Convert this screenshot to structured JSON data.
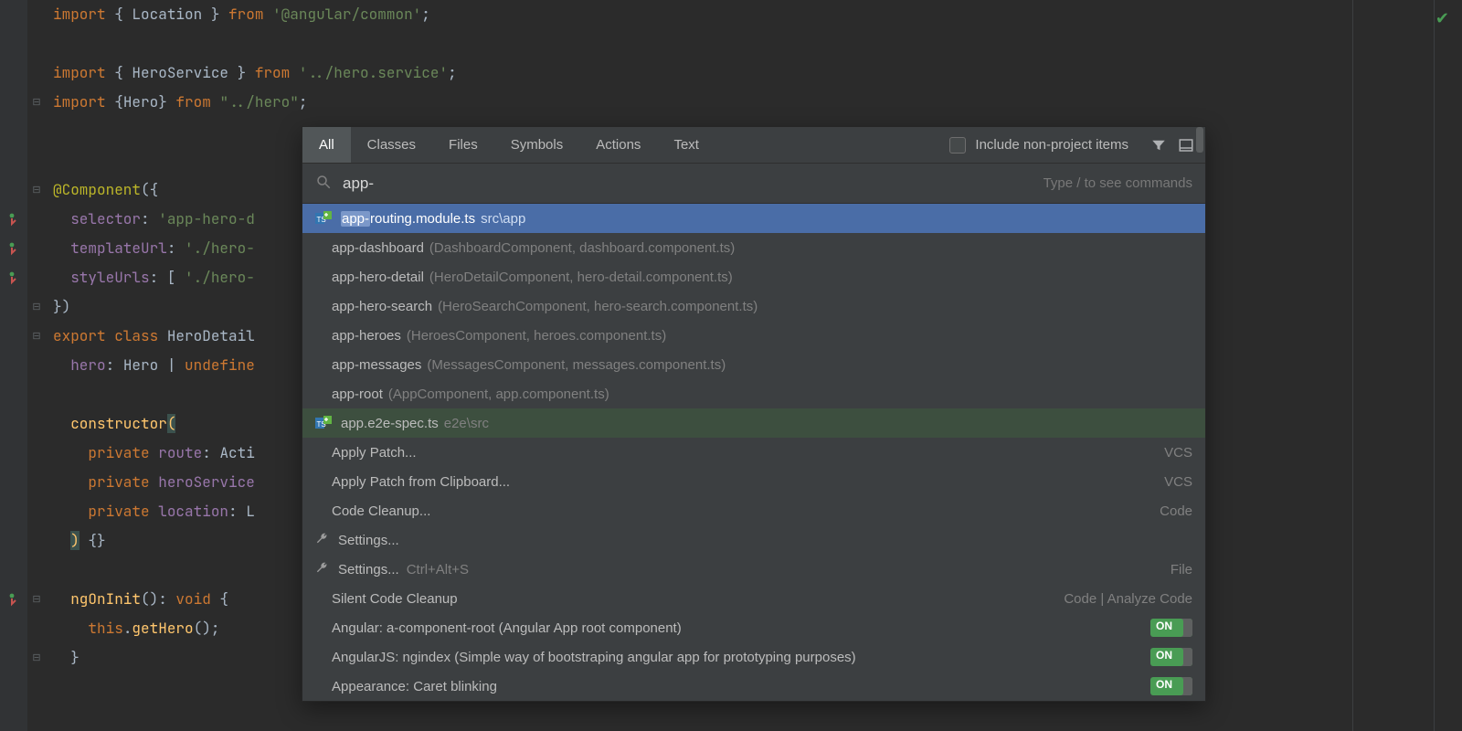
{
  "code": {
    "lines": [
      {
        "t": "import",
        "segs": [
          [
            "kw",
            "import"
          ],
          [
            "",
            " { "
          ],
          [
            "ident",
            "Location"
          ],
          [
            "",
            " } "
          ],
          [
            "kw",
            "from"
          ],
          [
            "",
            " "
          ],
          [
            "str",
            "'@angular/common'"
          ],
          [
            "",
            ";"
          ]
        ]
      },
      {
        "t": "blank"
      },
      {
        "t": "import",
        "segs": [
          [
            "kw",
            "import"
          ],
          [
            "",
            " { "
          ],
          [
            "ident",
            "HeroService"
          ],
          [
            "",
            " } "
          ],
          [
            "kw",
            "from"
          ],
          [
            "",
            " "
          ],
          [
            "str",
            "'../hero.service'"
          ],
          [
            "",
            ";"
          ]
        ]
      },
      {
        "t": "import",
        "segs": [
          [
            "kw",
            "import"
          ],
          [
            "",
            " {"
          ],
          [
            "ident",
            "Hero"
          ],
          [
            "",
            "} "
          ],
          [
            "kw",
            "from"
          ],
          [
            "",
            " "
          ],
          [
            "str",
            "\"../hero\""
          ],
          [
            "",
            ";"
          ]
        ]
      },
      {
        "t": "blank"
      },
      {
        "t": "blank"
      },
      {
        "t": "decor",
        "segs": [
          [
            "decor",
            "@Component"
          ],
          [
            "",
            "({"
          ]
        ]
      },
      {
        "t": "prop",
        "segs": [
          [
            "",
            "  "
          ],
          [
            "prop",
            "selector"
          ],
          [
            "",
            ": "
          ],
          [
            "str",
            "'app-hero-d"
          ]
        ]
      },
      {
        "t": "prop",
        "segs": [
          [
            "",
            "  "
          ],
          [
            "prop",
            "templateUrl"
          ],
          [
            "",
            ": "
          ],
          [
            "str",
            "'./hero-"
          ]
        ]
      },
      {
        "t": "prop",
        "segs": [
          [
            "",
            "  "
          ],
          [
            "prop",
            "styleUrls"
          ],
          [
            "",
            ": [ "
          ],
          [
            "str",
            "'./hero-"
          ]
        ]
      },
      {
        "t": "close",
        "segs": [
          [
            "",
            "})"
          ]
        ]
      },
      {
        "t": "class",
        "segs": [
          [
            "kw",
            "export class "
          ],
          [
            "ident",
            "HeroDetail"
          ]
        ]
      },
      {
        "t": "field",
        "segs": [
          [
            "",
            "  "
          ],
          [
            "prop",
            "hero"
          ],
          [
            "",
            ": "
          ],
          [
            "type",
            "Hero"
          ],
          [
            "",
            " | "
          ],
          [
            "kw",
            "undefine"
          ]
        ]
      },
      {
        "t": "blank"
      },
      {
        "t": "ctor",
        "segs": [
          [
            "",
            "  "
          ],
          [
            "fn",
            "constructor"
          ],
          [
            "par-y",
            "("
          ]
        ]
      },
      {
        "t": "param",
        "segs": [
          [
            "",
            "    "
          ],
          [
            "kw",
            "private "
          ],
          [
            "prop",
            "route"
          ],
          [
            "",
            ": "
          ],
          [
            "type",
            "Acti"
          ]
        ]
      },
      {
        "t": "param",
        "segs": [
          [
            "",
            "    "
          ],
          [
            "kw",
            "private "
          ],
          [
            "prop",
            "heroService"
          ]
        ]
      },
      {
        "t": "param",
        "segs": [
          [
            "",
            "    "
          ],
          [
            "kw",
            "private "
          ],
          [
            "prop",
            "location"
          ],
          [
            "",
            ": "
          ],
          [
            "type",
            "L"
          ]
        ]
      },
      {
        "t": "close",
        "segs": [
          [
            "",
            "  "
          ],
          [
            "par-y",
            ")"
          ],
          [
            "",
            " {}"
          ]
        ]
      },
      {
        "t": "blank"
      },
      {
        "t": "method",
        "segs": [
          [
            "",
            "  "
          ],
          [
            "fn",
            "ngOnInit"
          ],
          [
            "",
            "(): "
          ],
          [
            "kw",
            "void"
          ],
          [
            "",
            " {"
          ]
        ]
      },
      {
        "t": "call",
        "segs": [
          [
            "",
            "    "
          ],
          [
            "kw",
            "this"
          ],
          [
            "",
            "."
          ],
          [
            "fn",
            "getHero"
          ],
          [
            "",
            "();"
          ]
        ]
      },
      {
        "t": "close",
        "segs": [
          [
            "",
            "  }"
          ]
        ]
      },
      {
        "t": "blank"
      }
    ]
  },
  "gutter_marks": [
    {
      "line": 8,
      "kind": "implements"
    },
    {
      "line": 9,
      "kind": "implements"
    },
    {
      "line": 10,
      "kind": "implements"
    },
    {
      "line": 21,
      "kind": "implements"
    }
  ],
  "folds": [
    {
      "line": 4,
      "glyph": "⊟"
    },
    {
      "line": 7,
      "glyph": "⊟"
    },
    {
      "line": 11,
      "glyph": "⊟"
    },
    {
      "line": 12,
      "glyph": "⊟"
    },
    {
      "line": 15,
      "glyph": ""
    },
    {
      "line": 19,
      "glyph": ""
    },
    {
      "line": 21,
      "glyph": "⊟"
    },
    {
      "line": 23,
      "glyph": "⊟"
    }
  ],
  "popup": {
    "tabs": [
      "All",
      "Classes",
      "Files",
      "Symbols",
      "Actions",
      "Text"
    ],
    "active_tab": 0,
    "include_label": "Include non-project items",
    "query": "app-",
    "hint": "Type / to see commands",
    "results": [
      {
        "icon": "ts",
        "match": "app-",
        "label": "routing.module.ts",
        "dim": "src\\app",
        "selected": true
      },
      {
        "label": "app-dashboard",
        "dim": "(DashboardComponent, dashboard.component.ts)"
      },
      {
        "label": "app-hero-detail",
        "dim": "(HeroDetailComponent, hero-detail.component.ts)"
      },
      {
        "label": "app-hero-search",
        "dim": "(HeroSearchComponent, hero-search.component.ts)"
      },
      {
        "label": "app-heroes",
        "dim": "(HeroesComponent, heroes.component.ts)"
      },
      {
        "label": "app-messages",
        "dim": "(MessagesComponent, messages.component.ts)"
      },
      {
        "label": "app-root",
        "dim": "(AppComponent, app.component.ts)"
      },
      {
        "icon": "ts",
        "label": "app.e2e-spec.ts",
        "dim": "e2e\\src",
        "hl": true
      },
      {
        "label": "Apply Patch...",
        "right": "VCS"
      },
      {
        "label": "Apply Patch from Clipboard...",
        "right": "VCS"
      },
      {
        "label": "Code Cleanup...",
        "right": "Code"
      },
      {
        "icon": "wrench",
        "label": "Settings..."
      },
      {
        "icon": "wrench",
        "label": "Settings...",
        "shortcut": "Ctrl+Alt+S",
        "right": "File"
      },
      {
        "label": "Silent Code Cleanup",
        "right": "Code | Analyze Code"
      },
      {
        "label": "Angular: a-component-root (Angular App root component)",
        "toggle": "ON"
      },
      {
        "label": "AngularJS: ngindex (Simple way of bootstraping angular app for prototyping purposes)",
        "toggle": "ON"
      },
      {
        "label": "Appearance: Caret blinking",
        "toggle": "ON"
      }
    ]
  }
}
